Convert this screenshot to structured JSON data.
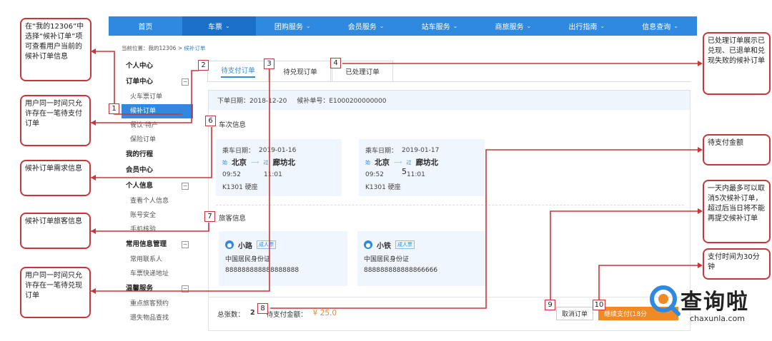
{
  "nav": {
    "items": [
      {
        "label": "首页",
        "chev": ""
      },
      {
        "label": "车票",
        "chev": "⌄"
      },
      {
        "label": "团购服务",
        "chev": "⌄"
      },
      {
        "label": "会员服务",
        "chev": "⌄"
      },
      {
        "label": "站车服务",
        "chev": "⌄"
      },
      {
        "label": "商旅服务",
        "chev": "⌄"
      },
      {
        "label": "出行指南",
        "chev": "⌄"
      },
      {
        "label": "信息查询",
        "chev": "⌄"
      }
    ]
  },
  "breadcrumb": {
    "prefix": "当前位置：我的12306 > ",
    "current": "候补订单"
  },
  "sidebar": {
    "personal_center": "个人中心",
    "order_center": "订单中心",
    "orders": [
      "火车票订单",
      "候补订单",
      "餐饮·特产",
      "保险订单"
    ],
    "my_trip": "我的行程",
    "member_center": "会员中心",
    "personal_info": "个人信息",
    "personal_items": [
      "查看个人信息",
      "账号安全",
      "手机核验"
    ],
    "common_info": "常用信息管理",
    "common_items": [
      "常用联系人",
      "车票快递地址"
    ],
    "warm_service": "温馨服务",
    "warm_items": [
      "重点旅客预约",
      "遗失物品查找"
    ],
    "toggle": "−"
  },
  "tabs": [
    "待支付订单",
    "待兑现订单",
    "已处理订单"
  ],
  "order": {
    "date_label": "下单日期：",
    "date": "2018-12-20",
    "no_label": "候补单号：",
    "no": "E1000200000000"
  },
  "train_section": "车次信息",
  "trains": [
    {
      "date_label": "乘车日期：",
      "date": "2019-01-16",
      "start_tag": "始",
      "from": "北京",
      "pass_tag": "过",
      "to": "廊坊北",
      "dep": "09:52",
      "arr": "11:01",
      "info": "K1301 硬座"
    },
    {
      "date_label": "乘车日期：",
      "date": "2019-01-17",
      "start_tag": "始",
      "from": "北京",
      "pass_tag": "过",
      "to": "廊坊北",
      "dep": "09:52",
      "arr": "11:01",
      "info": "K1301 硬座"
    }
  ],
  "train_mark": "5",
  "passenger_section": "旅客信息",
  "passengers": [
    {
      "name": "小路",
      "badge": "成人票",
      "id_type": "中国居民身份证",
      "id_no": "888888888888888888"
    },
    {
      "name": "小铁",
      "badge": "成人票",
      "id_type": "中国居民身份证",
      "id_no": "888888888888866666"
    }
  ],
  "footer": {
    "count_label": "总张数：",
    "count": "2",
    "amount_label": "待支付金额：",
    "amount": "¥ 25.0",
    "cancel": "取消订单",
    "pay": "继续支付(18分"
  },
  "callouts": {
    "c1": "在“我的12306”中选择“候补订单”项可查看用户当前的候补订单信息",
    "c2": "用户同一时间只允许存在一笔待支付订单",
    "c3": "候补订单需求信息",
    "c4": "候补订单旅客信息",
    "c5": "用户同一时间只允许存在一笔待兑现订单",
    "r1": "已处理订单展示已兑现、已退单和兑现失败的候补订单",
    "r2": "待支付金额",
    "r3": "一天内最多可以取消5次候补订单，超过后当日将不能再提交候补订单",
    "r4": "支付时间为30分钟"
  },
  "markers": [
    "1",
    "2",
    "3",
    "4",
    "6",
    "7",
    "8",
    "9",
    "10"
  ],
  "watermark": {
    "text": "查询啦",
    "url": "chaxunla.com"
  },
  "colors": {
    "nav": "#2f89e0",
    "callout_border": "#c9353a",
    "pay": "#f08a24"
  }
}
